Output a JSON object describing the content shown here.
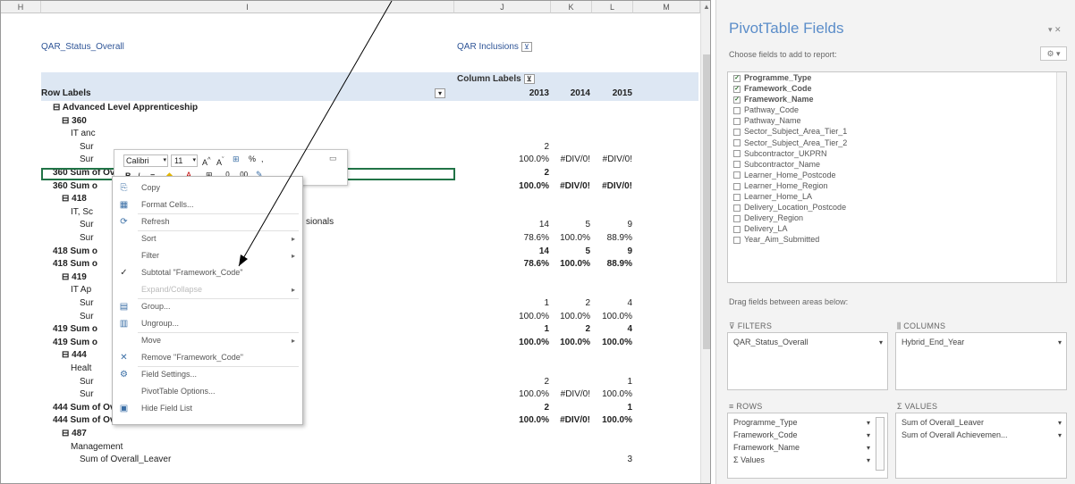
{
  "sheet": {
    "columns": [
      "H",
      "I",
      "J",
      "K",
      "L",
      "M"
    ],
    "header_filter_label": "QAR_Status_Overall",
    "header_filter_value": "QAR Inclusions",
    "column_labels_label": "Column Labels",
    "row_labels_label": "Row Labels",
    "years": [
      "2013",
      "2014",
      "2015"
    ],
    "rows": [
      {
        "label": "Advanced Level Apprenticeship",
        "indent": 0,
        "bold": true,
        "prefix": "⊟",
        "vals": [
          "",
          "",
          ""
        ]
      },
      {
        "label": "360",
        "indent": 1,
        "bold": true,
        "prefix": "⊟",
        "vals": [
          "",
          "",
          ""
        ]
      },
      {
        "label": "IT anc",
        "indent": 2,
        "bold": false,
        "prefix": "",
        "vals": [
          "",
          "",
          ""
        ]
      },
      {
        "label": "Sur",
        "indent": 3,
        "bold": false,
        "prefix": "",
        "vals": [
          "2",
          "",
          ""
        ]
      },
      {
        "label": "Sur",
        "indent": 3,
        "bold": false,
        "prefix": "",
        "vals": [
          "100.0%",
          "#DIV/0!",
          "#DIV/0!"
        ]
      },
      {
        "label": "360 Sum of Overall_Leaver",
        "indent": 0,
        "bold": true,
        "prefix": "",
        "vals": [
          "2",
          "",
          ""
        ]
      },
      {
        "label": "360 Sum o",
        "indent": 0,
        "bold": true,
        "prefix": "",
        "vals": [
          "100.0%",
          "#DIV/0!",
          "#DIV/0!"
        ]
      },
      {
        "label": "418",
        "indent": 1,
        "bold": true,
        "prefix": "⊟",
        "vals": [
          "",
          "",
          ""
        ]
      },
      {
        "label": "IT, Sc",
        "indent": 2,
        "bold": false,
        "prefix": "",
        "vals": [
          "",
          "",
          ""
        ]
      },
      {
        "label": "Sur",
        "indent": 3,
        "bold": false,
        "prefix": "",
        "vals": [
          "14",
          "5",
          "9"
        ]
      },
      {
        "label": "Sur",
        "indent": 3,
        "bold": false,
        "prefix": "",
        "vals": [
          "78.6%",
          "100.0%",
          "88.9%"
        ]
      },
      {
        "label": "418 Sum o",
        "indent": 0,
        "bold": true,
        "prefix": "",
        "vals": [
          "14",
          "5",
          "9"
        ]
      },
      {
        "label": "418 Sum o",
        "indent": 0,
        "bold": true,
        "prefix": "",
        "vals": [
          "78.6%",
          "100.0%",
          "88.9%"
        ]
      },
      {
        "label": "419",
        "indent": 1,
        "bold": true,
        "prefix": "⊟",
        "vals": [
          "",
          "",
          ""
        ]
      },
      {
        "label": "IT Ap",
        "indent": 2,
        "bold": false,
        "prefix": "",
        "vals": [
          "",
          "",
          ""
        ]
      },
      {
        "label": "Sur",
        "indent": 3,
        "bold": false,
        "prefix": "",
        "vals": [
          "1",
          "2",
          "4"
        ]
      },
      {
        "label": "Sur",
        "indent": 3,
        "bold": false,
        "prefix": "",
        "vals": [
          "100.0%",
          "100.0%",
          "100.0%"
        ]
      },
      {
        "label": "419 Sum o",
        "indent": 0,
        "bold": true,
        "prefix": "",
        "vals": [
          "1",
          "2",
          "4"
        ]
      },
      {
        "label": "419 Sum o",
        "indent": 0,
        "bold": true,
        "prefix": "",
        "vals": [
          "100.0%",
          "100.0%",
          "100.0%"
        ]
      },
      {
        "label": "444",
        "indent": 1,
        "bold": true,
        "prefix": "⊟",
        "vals": [
          "",
          "",
          ""
        ]
      },
      {
        "label": "Healt",
        "indent": 2,
        "bold": false,
        "prefix": "",
        "vals": [
          "",
          "",
          ""
        ]
      },
      {
        "label": "Sur",
        "indent": 3,
        "bold": false,
        "prefix": "",
        "vals": [
          "2",
          "",
          "1"
        ]
      },
      {
        "label": "Sur",
        "indent": 3,
        "bold": false,
        "prefix": "",
        "vals": [
          "100.0%",
          "#DIV/0!",
          "100.0%"
        ]
      },
      {
        "label": "444 Sum of Overall_Leaver",
        "indent": 0,
        "bold": true,
        "prefix": "",
        "vals": [
          "2",
          "",
          "1"
        ]
      },
      {
        "label": "444 Sum of Overall Achievement Rate",
        "indent": 0,
        "bold": true,
        "prefix": "",
        "vals": [
          "100.0%",
          "#DIV/0!",
          "100.0%"
        ]
      },
      {
        "label": "487",
        "indent": 1,
        "bold": true,
        "prefix": "⊟",
        "vals": [
          "",
          "",
          ""
        ]
      },
      {
        "label": "Management",
        "indent": 2,
        "bold": false,
        "prefix": "",
        "vals": [
          "",
          "",
          ""
        ]
      },
      {
        "label": "Sum of Overall_Leaver",
        "indent": 3,
        "bold": false,
        "prefix": "",
        "vals": [
          "",
          "",
          "3"
        ]
      }
    ],
    "partial_text_418": "sionals"
  },
  "mini_toolbar": {
    "font_name": "Calibri",
    "font_size": "11",
    "percent": "%"
  },
  "context_menu": {
    "items": [
      {
        "label": "Copy",
        "icon": "copy-icon",
        "glyph": "⎘",
        "enabled": true,
        "submenu": false,
        "check": false
      },
      {
        "label": "Format Cells...",
        "icon": "format-cells-icon",
        "glyph": "▦",
        "enabled": true,
        "submenu": false,
        "check": false
      },
      {
        "label": "Refresh",
        "icon": "refresh-icon",
        "glyph": "⟳",
        "enabled": true,
        "submenu": false,
        "check": false
      },
      {
        "label": "Sort",
        "icon": "",
        "glyph": "",
        "enabled": true,
        "submenu": true,
        "check": false
      },
      {
        "label": "Filter",
        "icon": "",
        "glyph": "",
        "enabled": true,
        "submenu": true,
        "check": false
      },
      {
        "label": "Subtotal \"Framework_Code\"",
        "icon": "check-icon",
        "glyph": "✓",
        "enabled": true,
        "submenu": false,
        "check": true
      },
      {
        "label": "Expand/Collapse",
        "icon": "",
        "glyph": "",
        "enabled": false,
        "submenu": true,
        "check": false
      },
      {
        "label": "Group...",
        "icon": "group-icon",
        "glyph": "▤",
        "enabled": true,
        "submenu": false,
        "check": false
      },
      {
        "label": "Ungroup...",
        "icon": "ungroup-icon",
        "glyph": "▥",
        "enabled": true,
        "submenu": false,
        "check": false
      },
      {
        "label": "Move",
        "icon": "",
        "glyph": "",
        "enabled": true,
        "submenu": true,
        "check": false
      },
      {
        "label": "Remove \"Framework_Code\"",
        "icon": "remove-icon",
        "glyph": "✕",
        "enabled": true,
        "submenu": false,
        "check": false
      },
      {
        "label": "Field Settings...",
        "icon": "field-settings-icon",
        "glyph": "⚙",
        "enabled": true,
        "submenu": false,
        "check": false
      },
      {
        "label": "PivotTable Options...",
        "icon": "",
        "glyph": "",
        "enabled": true,
        "submenu": false,
        "check": false
      },
      {
        "label": "Hide Field List",
        "icon": "field-list-icon",
        "glyph": "▣",
        "enabled": true,
        "submenu": false,
        "check": false
      }
    ]
  },
  "panel": {
    "title": "PivotTable Fields",
    "choose_label": "Choose fields to add to report:",
    "fields": [
      {
        "name": "Programme_Type",
        "checked": true
      },
      {
        "name": "Framework_Code",
        "checked": true
      },
      {
        "name": "Framework_Name",
        "checked": true
      },
      {
        "name": "Pathway_Code",
        "checked": false
      },
      {
        "name": "Pathway_Name",
        "checked": false
      },
      {
        "name": "Sector_Subject_Area_Tier_1",
        "checked": false
      },
      {
        "name": "Sector_Subject_Area_Tier_2",
        "checked": false
      },
      {
        "name": "Subcontractor_UKPRN",
        "checked": false
      },
      {
        "name": "Subcontractor_Name",
        "checked": false
      },
      {
        "name": "Learner_Home_Postcode",
        "checked": false
      },
      {
        "name": "Learner_Home_Region",
        "checked": false
      },
      {
        "name": "Learner_Home_LA",
        "checked": false
      },
      {
        "name": "Delivery_Location_Postcode",
        "checked": false
      },
      {
        "name": "Delivery_Region",
        "checked": false
      },
      {
        "name": "Delivery_LA",
        "checked": false
      },
      {
        "name": "Year_Aim_Submitted",
        "checked": false
      }
    ],
    "drag_label": "Drag fields between areas below:",
    "filters_label": "FILTERS",
    "columns_label": "COLUMNS",
    "rows_label": "ROWS",
    "values_label": "VALUES",
    "filters_items": [
      "QAR_Status_Overall"
    ],
    "columns_items": [
      "Hybrid_End_Year"
    ],
    "rows_items": [
      "Programme_Type",
      "Framework_Code",
      "Framework_Name",
      "Σ Values"
    ],
    "values_items": [
      "Sum of Overall_Leaver",
      "Sum of Overall Achievemen..."
    ]
  }
}
